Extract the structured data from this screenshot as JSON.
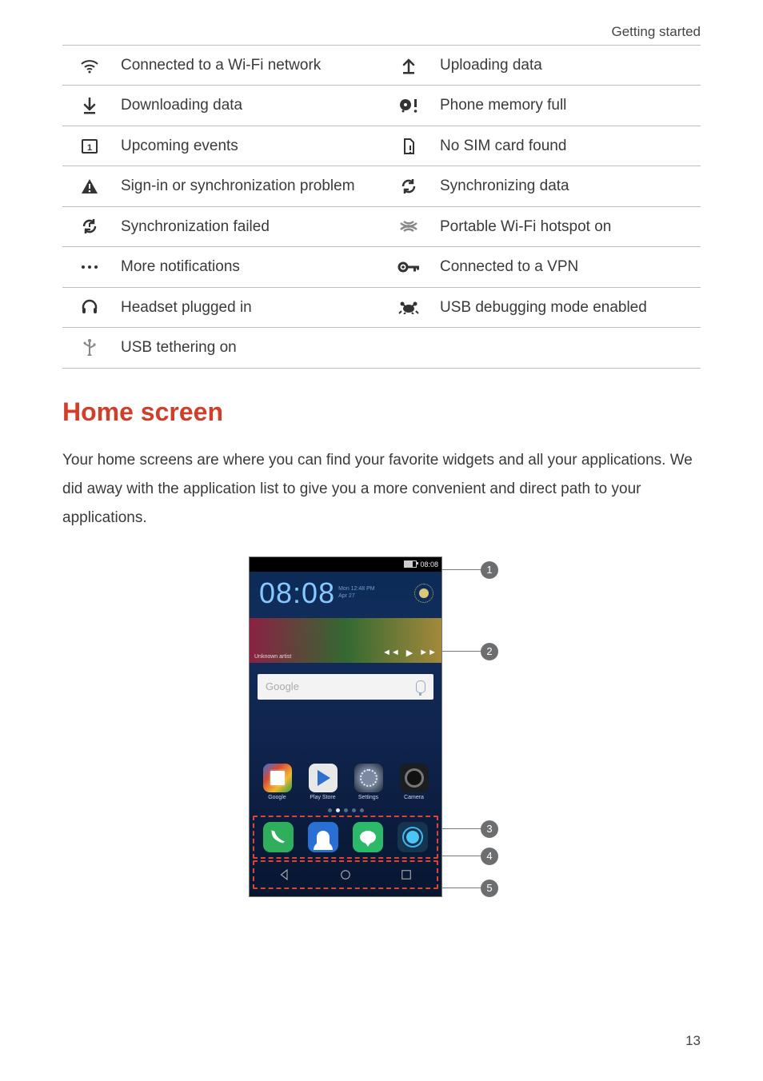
{
  "header": {
    "section": "Getting started"
  },
  "icon_table": [
    {
      "left": {
        "icon": "wifi-icon",
        "label": "Connected to a Wi-Fi network"
      },
      "right": {
        "icon": "upload-icon",
        "label": "Uploading data"
      }
    },
    {
      "left": {
        "icon": "download-icon",
        "label": "Downloading data"
      },
      "right": {
        "icon": "memory-full-icon",
        "label": "Phone memory full"
      }
    },
    {
      "left": {
        "icon": "calendar-icon",
        "label": "Upcoming events"
      },
      "right": {
        "icon": "no-sim-icon",
        "label": "No SIM card found"
      }
    },
    {
      "left": {
        "icon": "warning-icon",
        "label": "Sign-in or synchronization problem"
      },
      "right": {
        "icon": "sync-icon",
        "label": "Synchronizing data"
      }
    },
    {
      "left": {
        "icon": "sync-fail-icon",
        "label": "Synchronization failed"
      },
      "right": {
        "icon": "hotspot-icon",
        "label": "Portable Wi-Fi hotspot on"
      }
    },
    {
      "left": {
        "icon": "more-icon",
        "label": "More notifications"
      },
      "right": {
        "icon": "vpn-icon",
        "label": "Connected to a VPN"
      }
    },
    {
      "left": {
        "icon": "headset-icon",
        "label": "Headset plugged in"
      },
      "right": {
        "icon": "usb-debug-icon",
        "label": "USB debugging mode enabled"
      }
    },
    {
      "left": {
        "icon": "usb-tether-icon",
        "label": "USB tethering on"
      },
      "right": {
        "icon": "",
        "label": ""
      }
    }
  ],
  "heading": "Home screen",
  "paragraph": "Your home screens are where you can find your favorite widgets and all your applications. We did away with the application list to give you a more convenient and direct path to your applications.",
  "phone": {
    "status_bar": {
      "time": "08:08"
    },
    "clock": {
      "time": "08:08",
      "sub1": "Mon 12:48 PM",
      "sub2": "Apr 27"
    },
    "music_label": "Unknown artist",
    "search_placeholder": "Google",
    "apps": [
      {
        "name": "google-app",
        "label": "Google"
      },
      {
        "name": "play-app",
        "label": "Play Store"
      },
      {
        "name": "settings-app",
        "label": "Settings"
      },
      {
        "name": "camera-app",
        "label": "Camera"
      }
    ],
    "dock": [
      {
        "name": "dialer-app"
      },
      {
        "name": "contacts-app"
      },
      {
        "name": "messaging-app"
      },
      {
        "name": "browser-app"
      }
    ]
  },
  "callouts": {
    "c1": "1",
    "c2": "2",
    "c3": "3",
    "c4": "4",
    "c5": "5"
  },
  "page_number": "13"
}
